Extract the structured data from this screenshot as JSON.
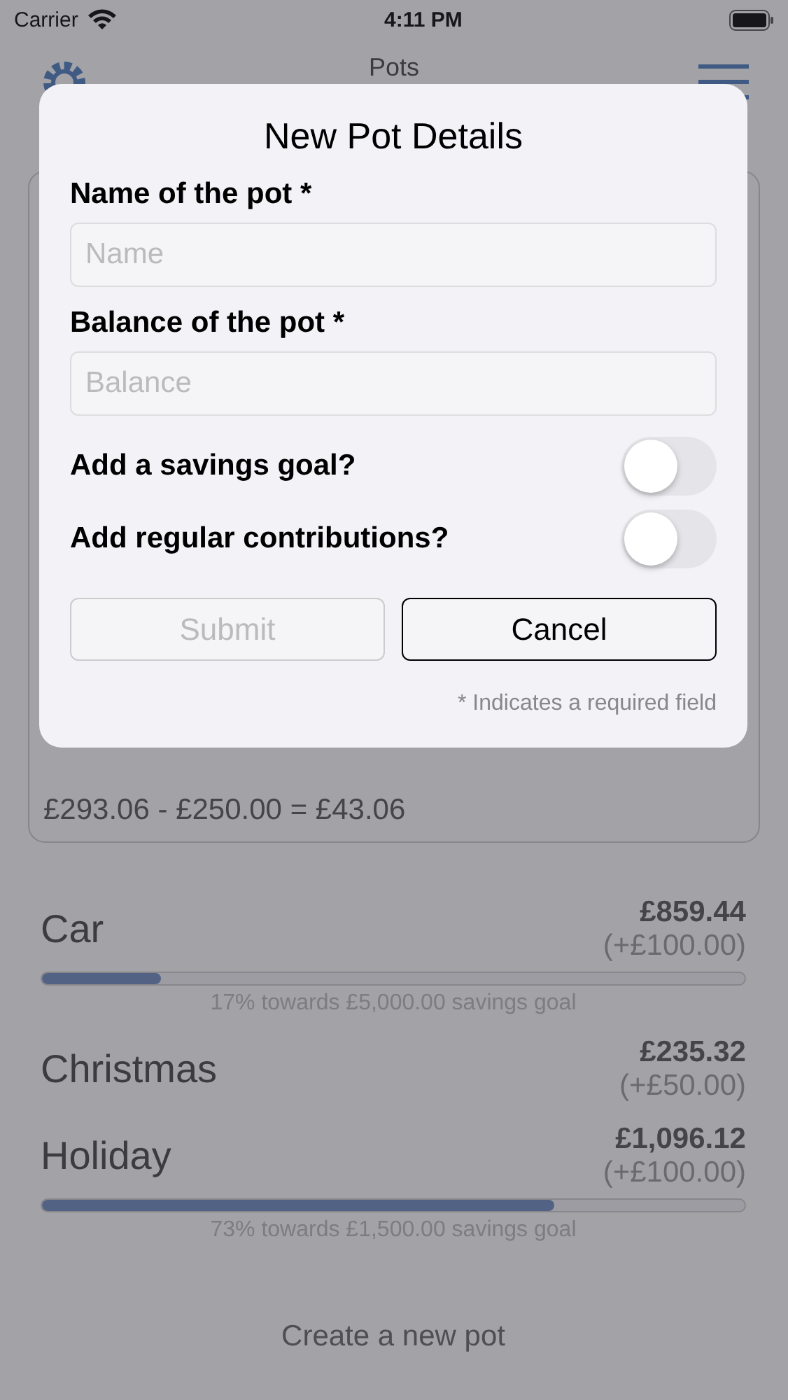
{
  "status_bar": {
    "carrier": "Carrier",
    "time": "4:11 PM"
  },
  "nav": {
    "title": "Pots"
  },
  "summary": {
    "calculation": "£293.06 - £250.00 = £43.06"
  },
  "pots": [
    {
      "name": "Car",
      "amount": "£859.44",
      "contribution": "(+£100.00)",
      "level": 0.17,
      "goal": "17% towards £5,000.00 savings goal"
    },
    {
      "name": "Christmas",
      "amount": "£235.32",
      "contribution": "(+£50.00)"
    },
    {
      "name": "Holiday",
      "amount": "£1,096.12",
      "contribution": "(+£100.00)",
      "level": 0.73,
      "goal": "73% towards £1,500.00 savings goal"
    }
  ],
  "create_button": "Create a new pot",
  "dialog": {
    "title": "New Pot Details",
    "fields": [
      {
        "label": "Name of the pot *",
        "placeholder": "Name"
      },
      {
        "label": "Balance of the pot *",
        "placeholder": "Balance"
      }
    ],
    "toggles": [
      {
        "label": "Add a savings goal?",
        "on": false
      },
      {
        "label": "Add regular contributions?",
        "on": false
      }
    ],
    "buttons": [
      {
        "label": "Submit",
        "disabled": true
      },
      {
        "label": "Cancel",
        "disabled": false
      }
    ],
    "footnote": "* Indicates a required field"
  }
}
